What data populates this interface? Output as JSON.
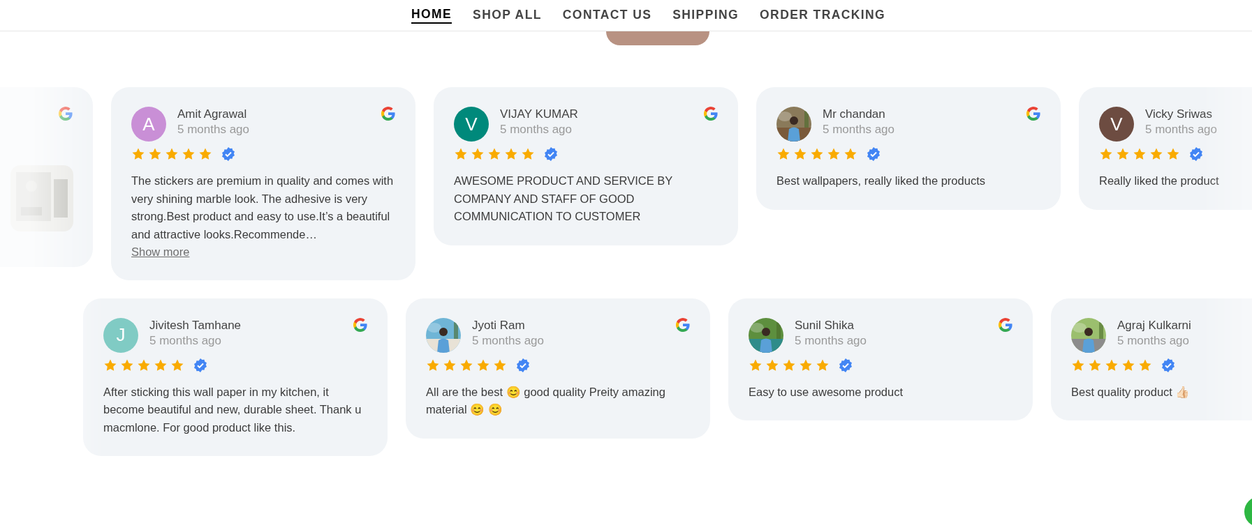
{
  "nav": {
    "items": [
      {
        "label": "HOME",
        "selected": true
      },
      {
        "label": "SHOP ALL",
        "selected": false
      },
      {
        "label": "CONTACT US",
        "selected": false
      },
      {
        "label": "SHIPPING",
        "selected": false
      },
      {
        "label": "ORDER TRACKING",
        "selected": false
      }
    ]
  },
  "rows": [
    {
      "cards": [
        {
          "kind": "edge"
        },
        {
          "kind": "review",
          "name": "Amit Agrawal",
          "time": "5 months ago",
          "avatar": {
            "kind": "letter",
            "letter": "A",
            "color": "#c98fd6"
          },
          "google": true,
          "stars": 5,
          "verified": true,
          "text": "The stickers are premium in quality and comes with very shining marble look. The adhesive is very strong.Best product and easy to use.It’s a beautiful and attractive looks.Recommende…",
          "show_more": "Show more"
        },
        {
          "kind": "review",
          "name": "VIJAY KUMAR",
          "time": "5 months ago",
          "avatar": {
            "kind": "letter",
            "letter": "V",
            "color": "#00897b"
          },
          "google": true,
          "stars": 5,
          "verified": true,
          "text": "AWESOME PRODUCT AND SERVICE BY COMPANY AND STAFF OF GOOD COMMUNICATION TO CUSTOMER"
        },
        {
          "kind": "review",
          "name": "Mr chandan",
          "time": "5 months ago",
          "google": true,
          "stars": 5,
          "verified": true,
          "text": "Best wallpapers, really liked the products"
        },
        {
          "kind": "review",
          "name": "Vicky Sriwas",
          "time": "5 months ago",
          "avatar": {
            "kind": "letter",
            "letter": "V",
            "color": "#6d4c41"
          },
          "stars": 5,
          "verified": true,
          "text": "Really liked the product"
        }
      ]
    },
    {
      "cards": [
        {
          "kind": "review",
          "name": "Jivitesh Tamhane",
          "time": "5 months ago",
          "avatar": {
            "kind": "letter",
            "letter": "J",
            "color": "#80cbc4"
          },
          "google": true,
          "stars": 5,
          "verified": true,
          "text": "After sticking this wall paper in my kitchen, it become beautiful and new, durable sheet. Thank u macmlone. For good product like this."
        },
        {
          "kind": "review",
          "name": "Jyoti Ram",
          "time": "5 months ago",
          "google": true,
          "stars": 5,
          "verified": true,
          "text": "All are the best 😊 good quality Preity amazing material 😊 😊"
        },
        {
          "kind": "review",
          "name": "Sunil Shika",
          "time": "5 months ago",
          "google": true,
          "stars": 5,
          "verified": true,
          "text": "Easy to use awesome product"
        },
        {
          "kind": "review",
          "name": "Agraj Kulkarni",
          "time": "5 months ago",
          "stars": 5,
          "verified": true,
          "text": "Best quality product 👍🏻"
        }
      ]
    }
  ]
}
